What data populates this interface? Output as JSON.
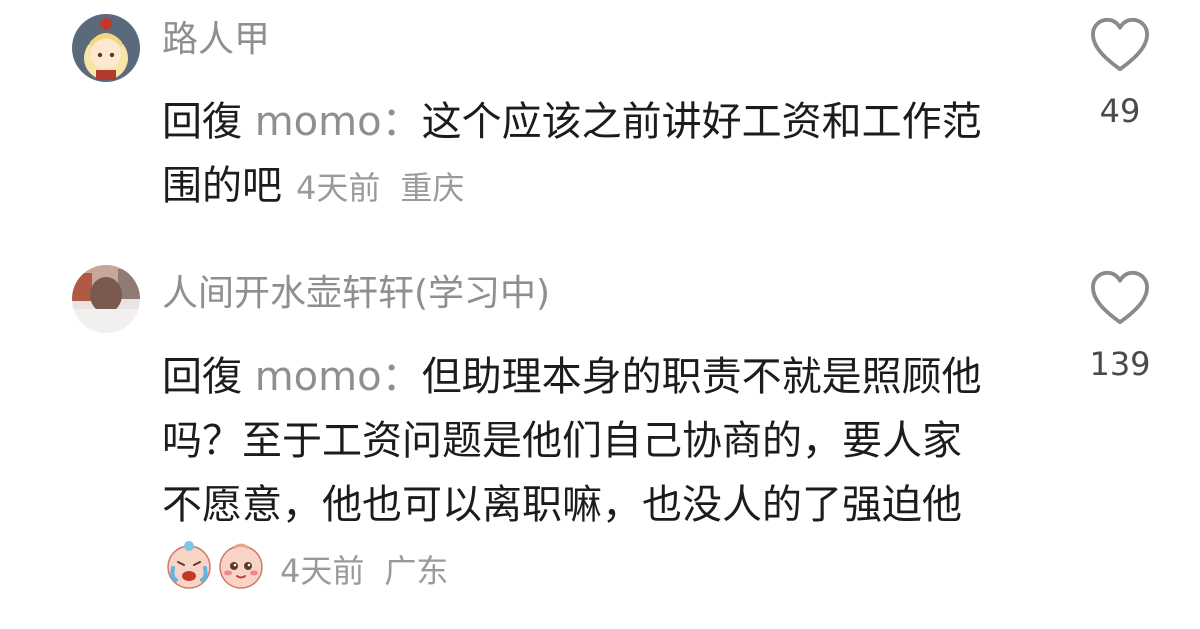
{
  "comments": [
    {
      "username": "路人甲",
      "reply_prefix": "回復",
      "reply_to": "momo：",
      "text": "这个应该之前讲好工资和工作范围的吧",
      "time": "4天前",
      "location": "重庆",
      "likes": "49",
      "avatar_icon": "anime-girl-avatar"
    },
    {
      "username": "人间开水壶轩轩(学习中)",
      "reply_prefix": "回復",
      "reply_to": "momo：",
      "text": "但助理本身的职责不就是照顾他吗？至于工资问题是他们自己协商的，要人家不愿意，他也可以离职嘛，也没人的了强迫他",
      "emojis": [
        "crying-face-emoji",
        "blushing-face-emoji"
      ],
      "time": "4天前",
      "location": "广东",
      "likes": "139",
      "avatar_icon": "photo-avatar"
    }
  ],
  "colors": {
    "text_primary": "#1c1c1e",
    "text_secondary": "#8e8e93",
    "heart_outline": "#8a8a8e"
  }
}
